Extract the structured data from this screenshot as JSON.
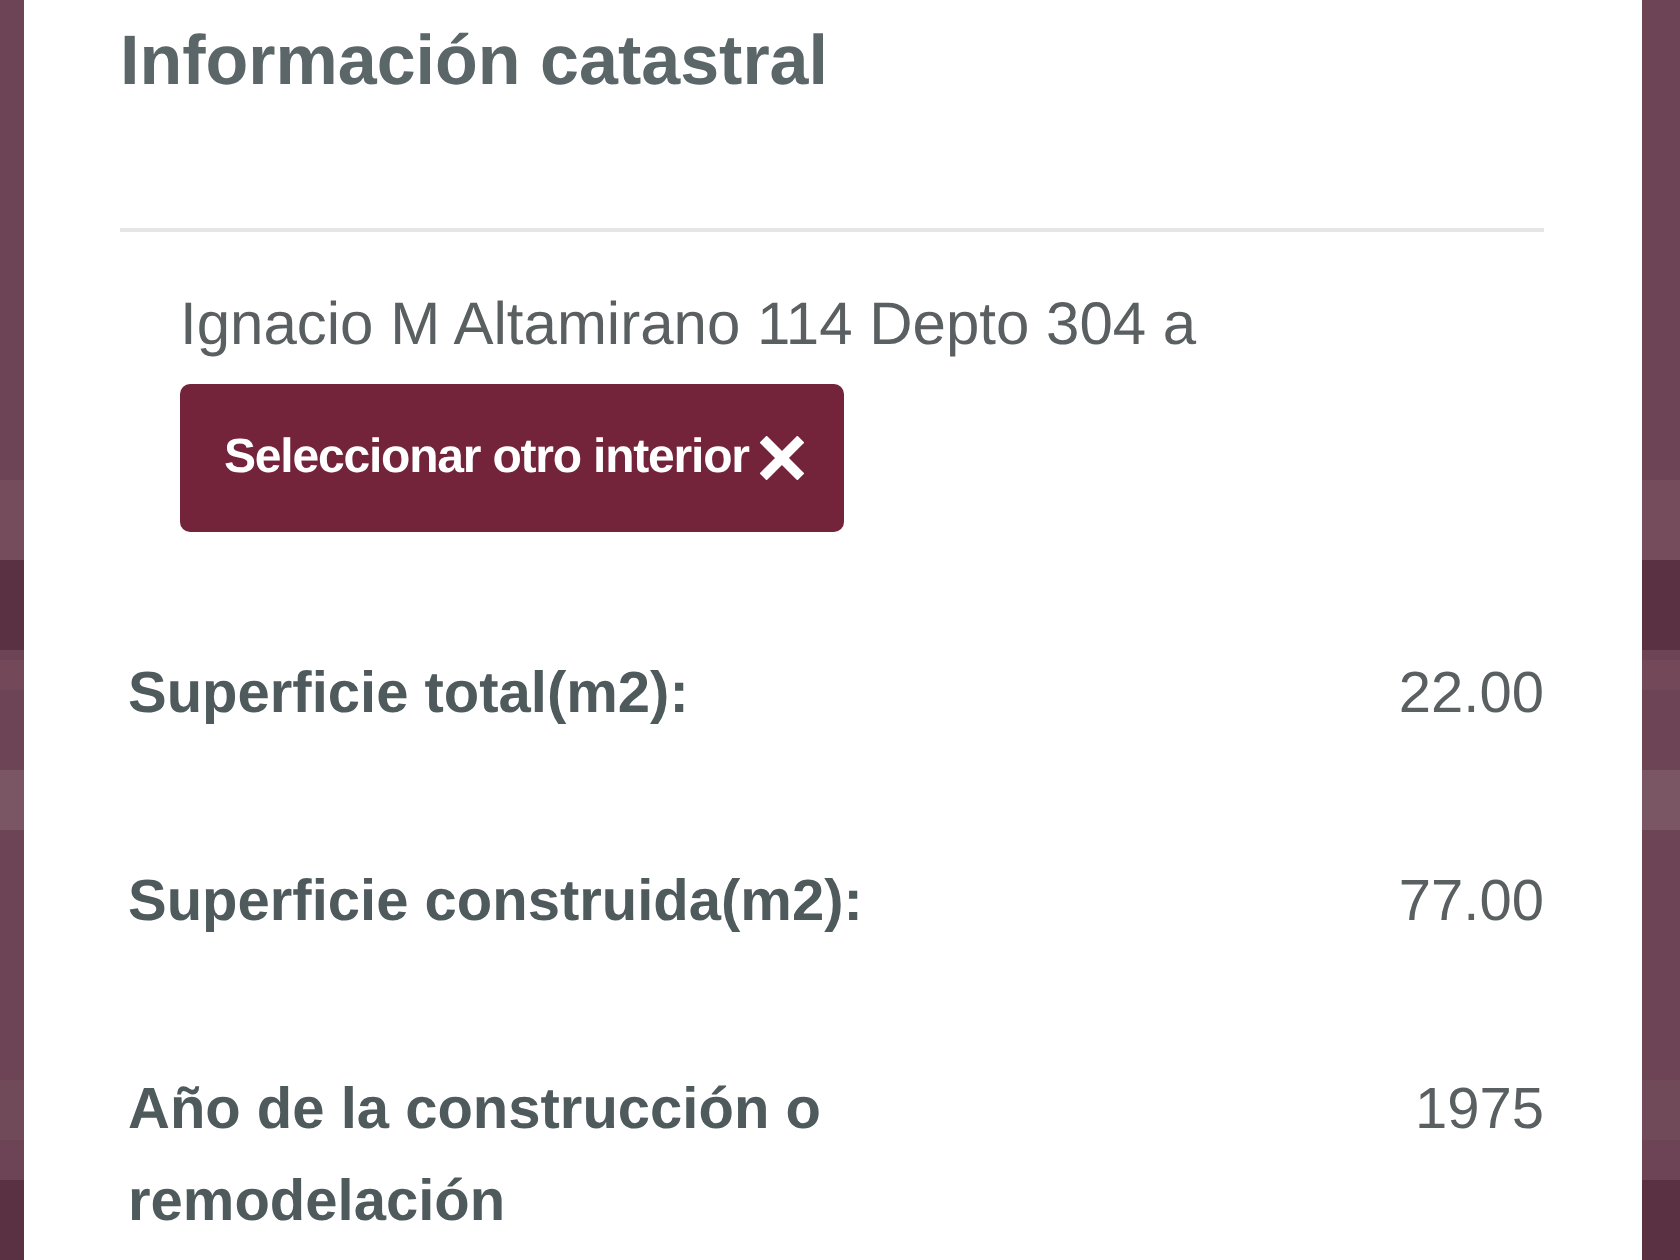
{
  "panel": {
    "title": "Información catastral",
    "address": "Ignacio M Altamirano 114 Depto 304 a",
    "button": "Seleccionar otro interior",
    "rows": [
      {
        "label": "Superficie total(m2):",
        "value": "22.00"
      },
      {
        "label": "Superficie construida(m2):",
        "value": "77.00"
      },
      {
        "label": "Año de la construcción o remodelación",
        "value": "1975"
      }
    ]
  }
}
